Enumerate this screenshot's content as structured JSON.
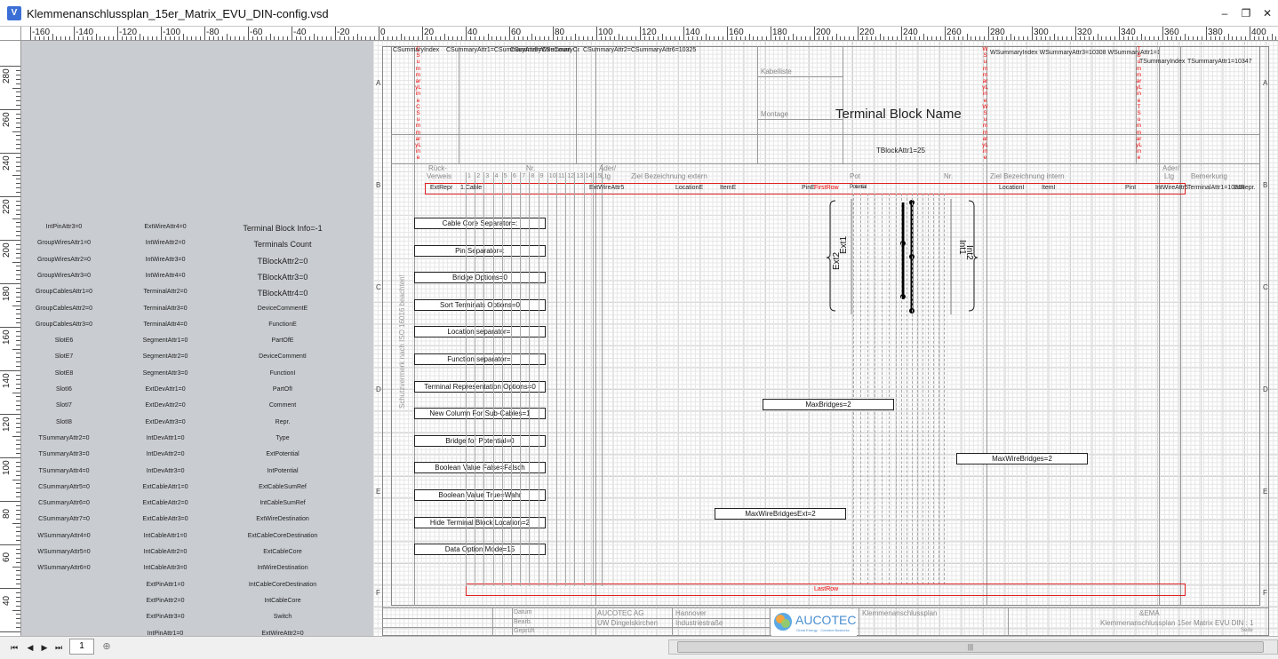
{
  "window": {
    "title": "Klemmenanschlussplan_15er_Matrix_EVU_DIN-config.vsd",
    "app_icon": "V",
    "buttons": {
      "minimize": "–",
      "maximize": "❐",
      "close": "✕"
    }
  },
  "ruler": {
    "h_labels": [
      "-160",
      "-140",
      "-120",
      "-100",
      "-80",
      "-60",
      "-40",
      "-20",
      "0",
      "20",
      "40",
      "60",
      "80",
      "100",
      "120",
      "140",
      "160",
      "180",
      "200",
      "220",
      "240",
      "260",
      "280",
      "300",
      "320",
      "340",
      "360",
      "380",
      "400"
    ],
    "v_labels": [
      "280",
      "260",
      "240",
      "220",
      "200",
      "180",
      "160",
      "140",
      "120",
      "100",
      "80",
      "60",
      "40",
      "20"
    ]
  },
  "pasteboard": {
    "col1": [
      "IntPinAttr3=0",
      "GroupWiresAttr1=0",
      "GroupWiresAttr2=0",
      "GroupWiresAttr3=0",
      "GroupCablesAttr1=0",
      "GroupCablesAttr2=0",
      "GroupCablesAttr3=0",
      "SlotE6",
      "SlotE7",
      "SlotE8",
      "SlotI6",
      "SlotI7",
      "SlotI8",
      "TSummaryAttr2=0",
      "TSummaryAttr3=0",
      "TSummaryAttr4=0",
      "CSummaryAttr5=0",
      "CSummaryAttr6=0",
      "CSummaryAttr7=0",
      "WSummaryAttr4=0",
      "WSummaryAttr5=0",
      "WSummaryAttr6=0"
    ],
    "col2": [
      "ExtWireAttr4=0",
      "IntWireAttr2=0",
      "IntWireAttr3=0",
      "IntWireAttr4=0",
      "TerminalAttr2=0",
      "TerminalAttr3=0",
      "TerminalAttr4=0",
      "SegmentAttr1=0",
      "SegmentAttr2=0",
      "SegmentAttr3=0",
      "ExtDevAttr1=0",
      "ExtDevAttr2=0",
      "ExtDevAttr3=0",
      "IntDevAttr1=0",
      "IntDevAttr2=0",
      "IntDevAttr3=0",
      "ExtCableAttr1=0",
      "ExtCableAttr2=0",
      "ExtCableAttr3=0",
      "IntCableAttr1=0",
      "IntCableAttr2=0",
      "IntCableAttr3=0",
      "ExtPinAttr1=0",
      "ExtPinAttr2=0",
      "ExtPinAttr3=0",
      "IntPinAttr1=0"
    ],
    "col3": [
      "Terminal Block Info=-1",
      "Terminals Count",
      "TBlockAttr2=0",
      "TBlockAttr3=0",
      "TBlockAttr4=0",
      "DeviceCommentE",
      "FunctionE",
      "PartOfE",
      "DeviceCommentI",
      "FunctionI",
      "PartOfI",
      "Comment",
      "Repr.",
      "Type",
      "ExtPotential",
      "IntPotential",
      "ExtCableSumRef",
      "IntCableSumRef",
      "ExtWireDestination",
      "ExtCableCoreDestination",
      "ExtCableCore",
      "IntWireDestination",
      "IntCableCoreDestination",
      "IntCableCore",
      "Switch",
      "ExtWireAttr2=0"
    ]
  },
  "sheet": {
    "zones": [
      "A",
      "B",
      "C",
      "D",
      "E",
      "F"
    ],
    "top_texts": {
      "csummary_index": "CSummaryIndex",
      "csummary_attr1": "CSummaryAttr1=CSummaryAttr5=CSummaryCount",
      "wire_count": "CSummaryWireCount",
      "csummary_attr2": "CSummaryAttr2=CSummaryAttr6=10325",
      "wsummary": "WSummaryIndex WSummaryAttr3=10308 WSummaryAttr1=10308",
      "tsummary_index": "TSummaryIndex",
      "tsummary_attr1": "TSummaryAttr1=10347"
    },
    "vertical_red_1": "CSummaryLine CSummaryLine",
    "vertical_red_2": "WSummaryLine WSummaryLine",
    "vertical_red_3": "TSummaryLine TSummaryLine",
    "kabelliste": "Kabelliste",
    "montage": "Montage",
    "block_name": "Terminal Block Name",
    "tblock_attr1": "TBlockAttr1=25",
    "header": {
      "rueck": "Rück-",
      "verweis": "Verweis",
      "nr": "Nr.",
      "ader": "Ader/",
      "ltg": "Ltg",
      "ziel_extern": "Ziel Bezeichnung extern",
      "pot": "Pot",
      "nr2": "Nr.",
      "ziel_intern": "Ziel Bezeichnung intern",
      "ader2": "Ader/",
      "ltg2": "Ltg",
      "bemerkung": "Bemerkung"
    },
    "core_numbers": [
      "1",
      "2",
      "3",
      "4",
      "5",
      "6",
      "7",
      "8",
      "9",
      "10",
      "11",
      "12",
      "13",
      "14",
      "15"
    ],
    "row": {
      "ext_repr": "ExtRepr",
      "cable": "1.Cable",
      "ext_wire": "ExtWireAttr5",
      "location_e": "LocationE",
      "item_e": "ItemE",
      "pin_e": "PinE",
      "first_row": "FirstRow",
      "location_i": "LocationI",
      "item_i": "ItemI",
      "pin_i": "PinI",
      "int_wire": "IntWireAttr5",
      "terminal_attr1": "TerminalAttr1=10318",
      "int_repr": "IntRepr."
    },
    "options": [
      "Cable Core Separator=:",
      "Pin Separator=:",
      "Bridge Options=0",
      "Sort Terminals Options=0",
      "Location separator=:",
      "Function separator=:",
      "Terminal Representation Options=0",
      "New Column For Sub-Cables=1",
      "Bridge for Potential=0",
      "Boolean Value False=Falsch",
      "Boolean Value True=Wahr",
      "Hide Terminal Block Location=2",
      "Data Option Mode=15"
    ],
    "max_bridges": "MaxBridges=2",
    "max_wire_bridges": "MaxWireBridges=2",
    "max_wire_bridges_ext": "MaxWireBridgesExt=2",
    "ext1": "Ext1",
    "ext2": "Ext2",
    "int1": "Int1",
    "int2": "Int2",
    "last_row": "LastRow",
    "copyright": "Schutzvermerk nach ISO 16016 beachten!",
    "titleblock": {
      "datum": "Datum",
      "bearb": "Bearb.",
      "gepr": "Geprüft",
      "company": "AUCOTEC AG",
      "company2": "UW Dingelskirchen",
      "city": "Hannover",
      "street": "Industriestraße",
      "logo": "AUCOTEC",
      "logo_sub": "Great Energy · Connect Business",
      "doc_title": "Klemmenanschlussplan",
      "ema": "&EMA",
      "file": "Klemmenanschlussplan 15er Matrix EVU DIN : 1",
      "blatt": "Seite"
    }
  },
  "tabs": {
    "page": "1"
  }
}
